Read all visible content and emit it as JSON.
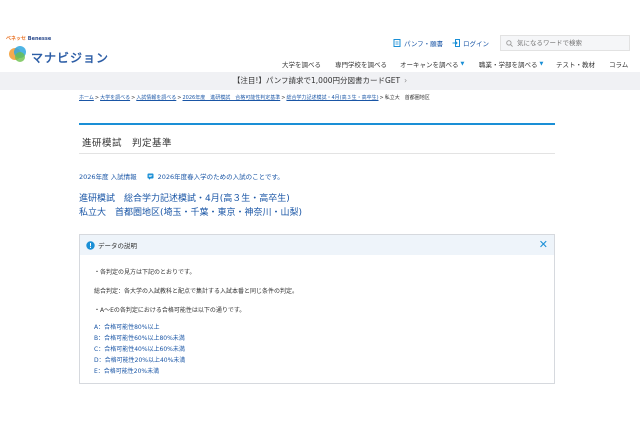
{
  "brand": {
    "company": "Benesse",
    "company_mark": "ベネッセ",
    "site_name": "マナビジョン"
  },
  "header": {
    "pamphlet_label": "パンフ・願書",
    "login_label": "ログイン",
    "search_placeholder": "気になるワードで検索"
  },
  "nav": {
    "items": [
      {
        "label": "大学を調べる"
      },
      {
        "label": "専門学校を調べる"
      },
      {
        "label": "オーキャンを調べる"
      },
      {
        "label": "職業・学部を調べる"
      },
      {
        "label": "テスト・教材"
      },
      {
        "label": "コラム"
      }
    ]
  },
  "banner": {
    "text": "【注目!】パンフ請求で1,000円分図書カードGET"
  },
  "breadcrumb": {
    "items": [
      "ホーム",
      "大学を調べる",
      "入試情報を調べる",
      "2026年度　進研模試　合格可能性判定基準",
      "総合学力記述模試・4月(高３生・高卒生)"
    ],
    "current": "私立大　首都圏地区"
  },
  "page": {
    "title": "進研模試　判定基準",
    "year_label": "2026年度 入試情報",
    "year_note": "2026年度春入学のための入試のことです。",
    "exam_title": "進研模試　総合学力記述模試・4月(高３生・高卒生)",
    "region_title": "私立大　首都圏地区(埼玉・千葉・東京・神奈川・山梨)"
  },
  "data_box": {
    "title": "データの説明",
    "lines": [
      "・各判定の見方は下記のとおりです。",
      "総合判定：各大学の入試教科と配点で集計する入試本番と同じ条件の判定。",
      "・A～Eの各判定における合格可能性は以下の通りです。"
    ],
    "grades": [
      "A：合格可能性80%以上",
      "B：合格可能性60%以上80%未満",
      "C：合格可能性40%以上60%未満",
      "D：合格可能性20%以上40%未満",
      "E：合格可能性20%未満"
    ]
  },
  "colors": {
    "accent": "#1a8fd6",
    "link": "#1a56a6",
    "banner_bg": "#f0f1f4",
    "box_header_bg": "#eef4fa"
  },
  "icons": [
    "logo-mark-icon",
    "document-icon",
    "login-icon",
    "search-icon",
    "chevron-down-icon",
    "chevron-right-icon",
    "info-icon",
    "close-icon",
    "note-icon"
  ]
}
